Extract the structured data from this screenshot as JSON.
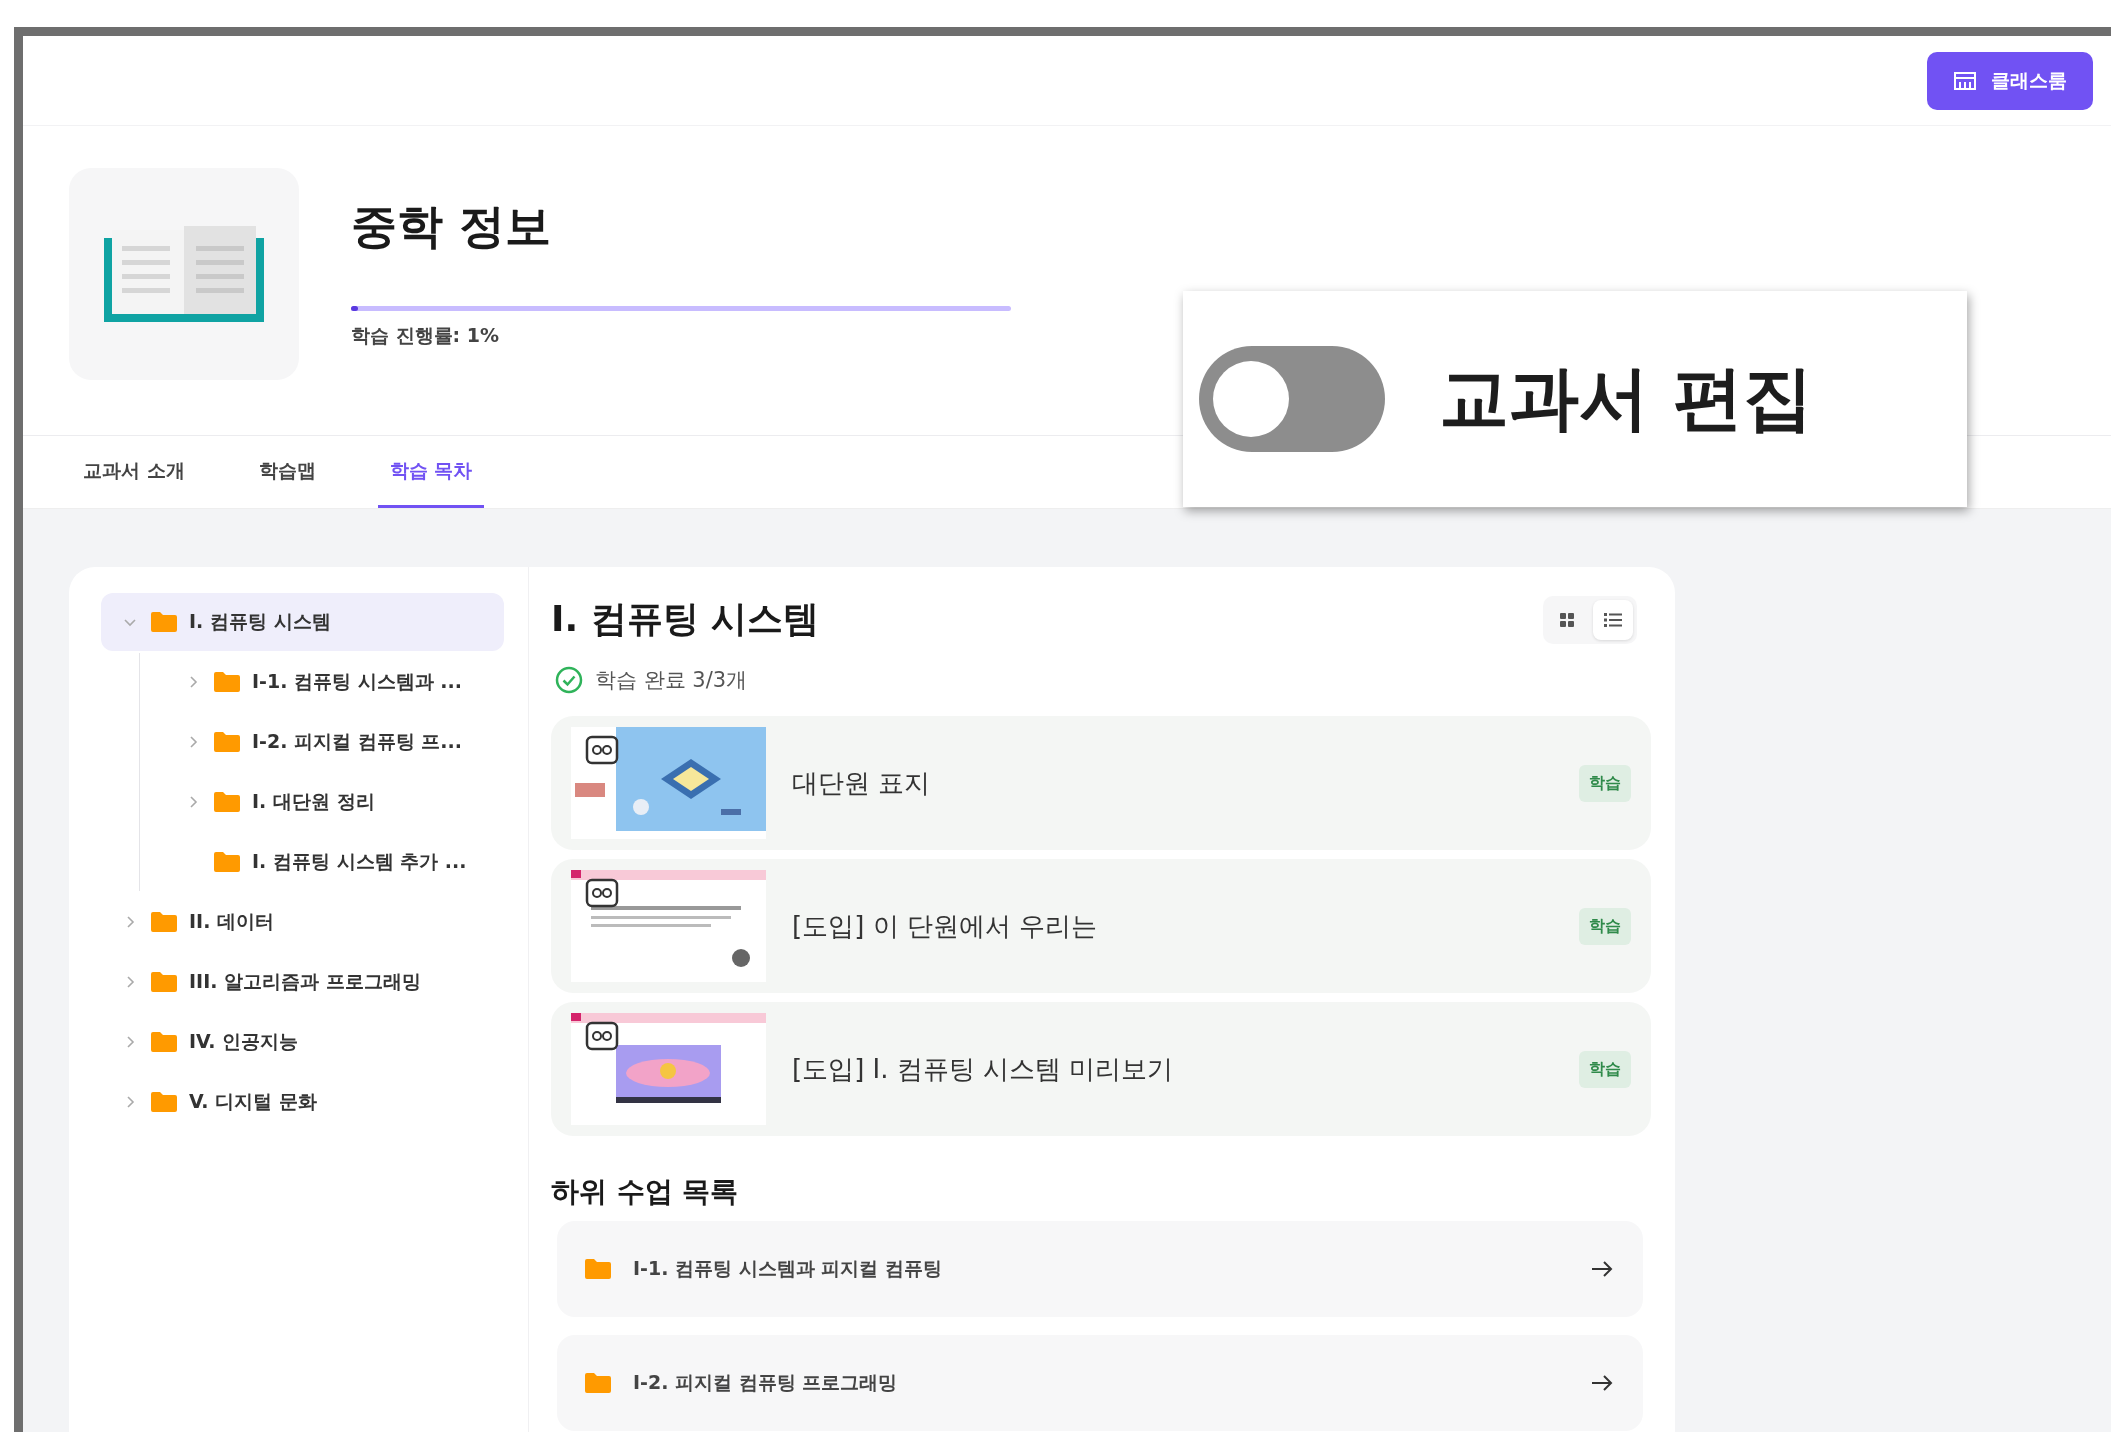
{
  "header": {
    "classroom_button": "클래스룸"
  },
  "textbook": {
    "title": "중학 정보",
    "progress": {
      "level": 0.01,
      "label": "학습 진행률: 1%"
    }
  },
  "tabs": [
    {
      "label": "교과서 소개",
      "selected": false
    },
    {
      "label": "학습맵",
      "selected": false
    },
    {
      "label": "학습 목차",
      "selected": true
    }
  ],
  "edit_toggle": {
    "label": "교과서 편집",
    "on": false
  },
  "tree": [
    {
      "label": "I. 컴퓨팅 시스템",
      "selected": true,
      "expandable": true,
      "expanded": true,
      "children": [
        {
          "label": "I-1. 컴퓨팅 시스템과 ...",
          "selected": false,
          "expandable": true,
          "expanded": false
        },
        {
          "label": "I-2. 피지컬 컴퓨팅 프...",
          "selected": false,
          "expandable": true,
          "expanded": false
        },
        {
          "label": "I. 대단원 정리",
          "selected": false,
          "expandable": true,
          "expanded": false
        },
        {
          "label": "I. 컴퓨팅 시스템 추가 ...",
          "selected": false,
          "expandable": false,
          "expanded": false
        }
      ]
    },
    {
      "label": "II. 데이터",
      "selected": false,
      "expandable": true,
      "expanded": false
    },
    {
      "label": "III. 알고리즘과 프로그래밍",
      "selected": false,
      "expandable": true,
      "expanded": false
    },
    {
      "label": "IV. 인공지능",
      "selected": false,
      "expandable": true,
      "expanded": false
    },
    {
      "label": "V. 디지털 문화",
      "selected": false,
      "expandable": true,
      "expanded": false
    }
  ],
  "section": {
    "title": "I. 컴퓨팅 시스템",
    "view_modes": [
      {
        "kind": "grid",
        "selected": false
      },
      {
        "kind": "list",
        "selected": true
      }
    ],
    "status": "학습 완료 3/3개",
    "lessons": [
      {
        "title": "대단원 표지",
        "badge": "학습",
        "kind": "picture"
      },
      {
        "title": "[도입] 이 단원에서 우리는",
        "badge": "학습",
        "kind": "picture"
      },
      {
        "title": "[도입] I. 컴퓨팅 시스템 미리보기",
        "badge": "학습",
        "kind": "picture"
      }
    ],
    "sub_heading": "하위 수업 목록",
    "sub_lessons": [
      {
        "label": "I-1. 컴퓨팅 시스템과 피지컬 컴퓨팅"
      },
      {
        "label": "I-2. 피지컬 컴퓨팅 프로그래밍"
      }
    ]
  }
}
